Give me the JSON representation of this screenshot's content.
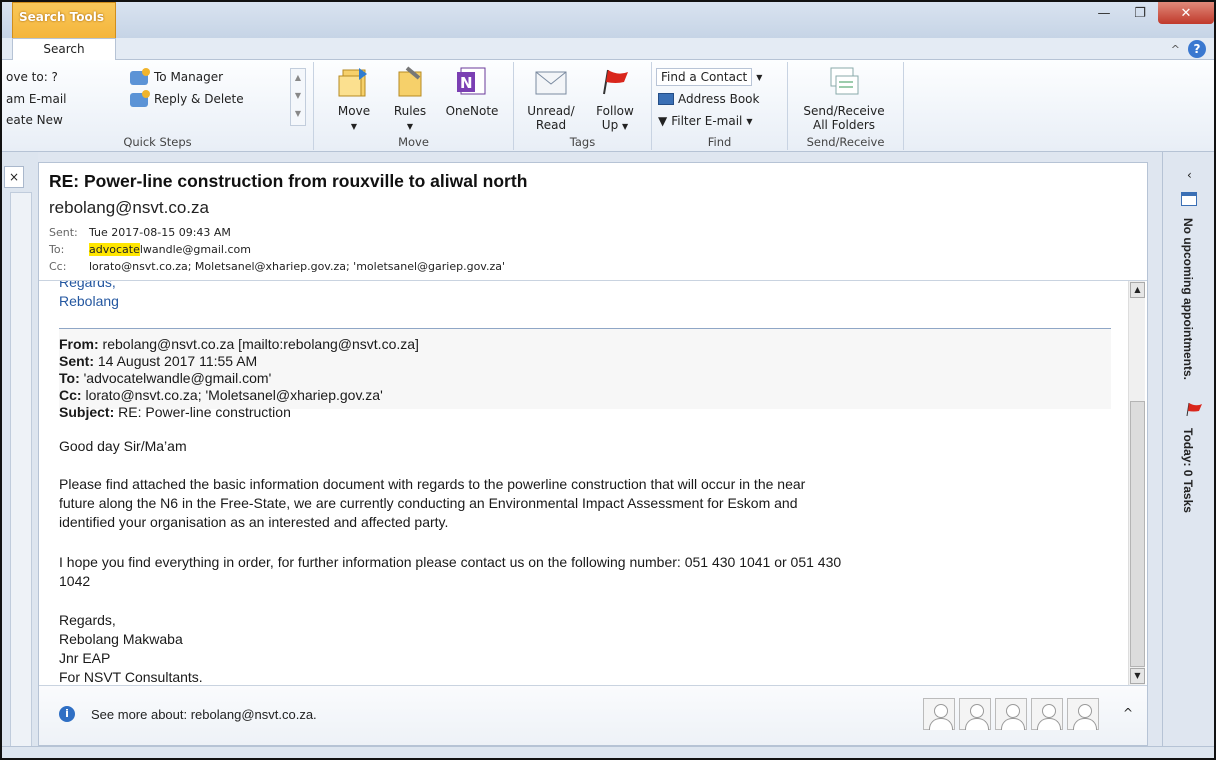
{
  "window": {
    "context_tab": "Search Tools",
    "active_tab": "Search"
  },
  "ribbon": {
    "quick_steps": {
      "items": [
        "ove to: ?",
        "To Manager",
        "am E-mail",
        "Reply & Delete",
        "eate New"
      ],
      "label": "Quick Steps"
    },
    "move": {
      "move": "Move",
      "rules": "Rules",
      "onenote": "OneNote",
      "label": "Move"
    },
    "tags": {
      "unread_1": "Unread/",
      "unread_2": "Read",
      "follow_1": "Follow",
      "follow_2": "Up",
      "label": "Tags"
    },
    "find": {
      "find_contact": "Find a Contact",
      "address_book": "Address Book",
      "filter_email": "Filter E-mail",
      "label": "Find"
    },
    "send_receive": {
      "line1": "Send/Receive",
      "line2": "All Folders",
      "label": "Send/Receive"
    }
  },
  "message": {
    "subject": "RE: Power-line construction from rouxville to aliwal north",
    "sender": "rebolang@nsvt.co.za",
    "sent_label": "Sent:",
    "sent": "Tue 2017-08-15 09:43 AM",
    "to_label": "To:",
    "to_highlight": "advocate",
    "to_rest": "lwandle@gmail.com",
    "cc_label": "Cc:",
    "cc": "lorato@nsvt.co.za; Moletsanel@xhariep.gov.za; 'moletsanel@gariep.gov.za'"
  },
  "body": {
    "top_regards": "Regards,",
    "top_name": "Rebolang",
    "quote_from_label": "From:",
    "quote_from": " rebolang@nsvt.co.za [mailto:rebolang@nsvt.co.za]",
    "quote_sent_label": "Sent:",
    "quote_sent": " 14 August 2017 11:55 AM",
    "quote_to_label": "To:",
    "quote_to": " 'advocatelwandle@gmail.com'",
    "quote_cc_label": "Cc:",
    "quote_cc": " lorato@nsvt.co.za; 'Moletsanel@xhariep.gov.za'",
    "quote_subject_label": "Subject:",
    "quote_subject": " RE: Power-line construction",
    "greeting": "Good day Sir/Ma’am",
    "para1_line1": "Please find attached the basic information document with regards to the powerline construction that will occur in the near",
    "para1_line2": "future along the N6 in the Free-State, we are currently conducting an Environmental Impact Assessment for Eskom and",
    "para1_line3": "identified your organisation as an interested and affected party.",
    "para2_line1": "I hope you find everything in order, for further information please contact us on the following number: 051 430 1041 or 051 430",
    "para2_line2": "1042",
    "sig_regards": "Regards,",
    "sig_name": "Rebolang Makwaba",
    "sig_title": "Jnr EAP",
    "sig_company": "For NSVT Consultants."
  },
  "people_pane": {
    "see_more": "See more about: rebolang@nsvt.co.za."
  },
  "todo_bar": {
    "appointments": "No upcoming appointments.",
    "tasks": "Today: 0 Tasks"
  }
}
